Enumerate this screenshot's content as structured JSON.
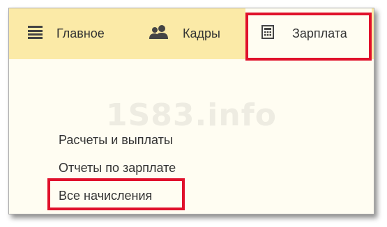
{
  "topbar": {
    "tabs": [
      {
        "label": "Главное",
        "icon": "menu-lines-icon"
      },
      {
        "label": "Кадры",
        "icon": "people-icon"
      },
      {
        "label": "Зарплата",
        "icon": "calculator-icon",
        "selected": true
      }
    ]
  },
  "watermark": "1S83.info",
  "menu": {
    "items": [
      {
        "label": "Расчеты и выплаты"
      },
      {
        "label": "Отчеты по зарплате"
      },
      {
        "label": "Все начисления",
        "highlighted": true
      }
    ]
  },
  "colors": {
    "topbar_bg": "#fbeaa7",
    "content_bg": "#fffdf2",
    "highlight": "#e0112b",
    "text": "#333333"
  }
}
